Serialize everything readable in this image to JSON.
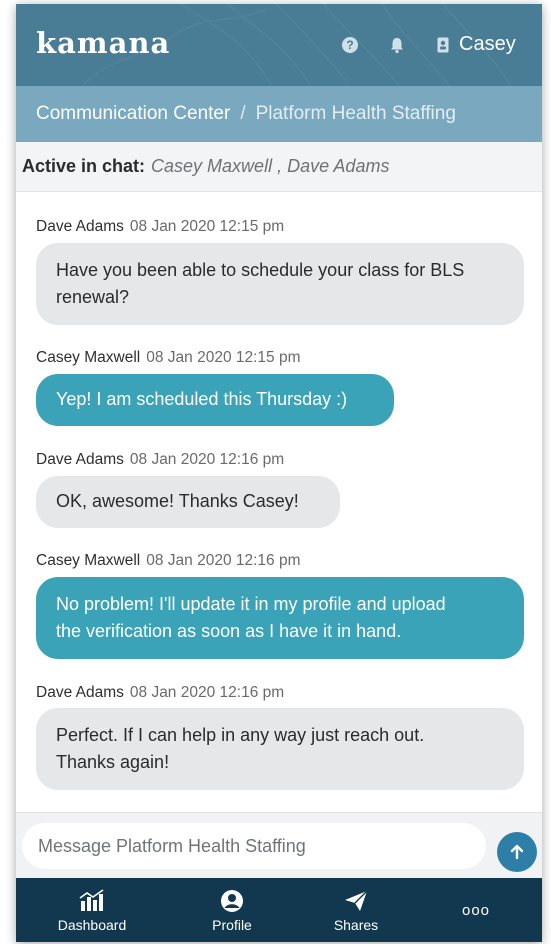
{
  "header": {
    "logo": "kamana",
    "user_name": "Casey",
    "icons": [
      "help-icon",
      "bell-icon",
      "user-icon"
    ]
  },
  "breadcrumb": {
    "root": "Communication Center",
    "separator": "/",
    "current": "Platform Health Staffing"
  },
  "active_chat": {
    "label": "Active in chat:",
    "names": "Casey Maxwell , Dave Adams"
  },
  "messages": [
    {
      "sender": "Dave Adams",
      "time": "08 Jan 2020 12:15 pm",
      "direction": "incoming",
      "lines": [
        "Have you been able to schedule your class for BLS",
        "renewal?"
      ]
    },
    {
      "sender": "Casey Maxwell",
      "time": "08 Jan 2020 12:15 pm",
      "direction": "outgoing",
      "lines": [
        "Yep! I am scheduled this Thursday :)"
      ]
    },
    {
      "sender": "Dave Adams",
      "time": "08 Jan 2020 12:16 pm",
      "direction": "incoming",
      "lines": [
        "OK, awesome! Thanks Casey!"
      ]
    },
    {
      "sender": "Casey Maxwell",
      "time": "08 Jan 2020 12:16 pm",
      "direction": "outgoing",
      "lines": [
        "No problem! I'll update it in my profile and upload",
        "the verification as soon as I have it in hand."
      ]
    },
    {
      "sender": "Dave Adams",
      "time": "08 Jan 2020 12:16 pm",
      "direction": "incoming",
      "lines": [
        "Perfect. If I can help in any way just reach out.",
        "Thanks again!"
      ]
    }
  ],
  "composer": {
    "placeholder": "Message Platform Health Staffing",
    "send_icon": "arrow-up-icon"
  },
  "bottom_nav": {
    "items": [
      {
        "label": "Dashboard",
        "icon": "bar-chart-icon"
      },
      {
        "label": "Profile",
        "icon": "profile-icon"
      },
      {
        "label": "Shares",
        "icon": "paper-plane-icon"
      },
      {
        "label": "ooo",
        "icon": "more-icon"
      }
    ]
  },
  "colors": {
    "header": "#497d96",
    "breadcrumb": "#79a8bf",
    "outgoing_bubble": "#3aa3b8",
    "incoming_bubble": "#e6e7e9",
    "nav": "#12384f",
    "send_button": "#2e7fa8"
  }
}
